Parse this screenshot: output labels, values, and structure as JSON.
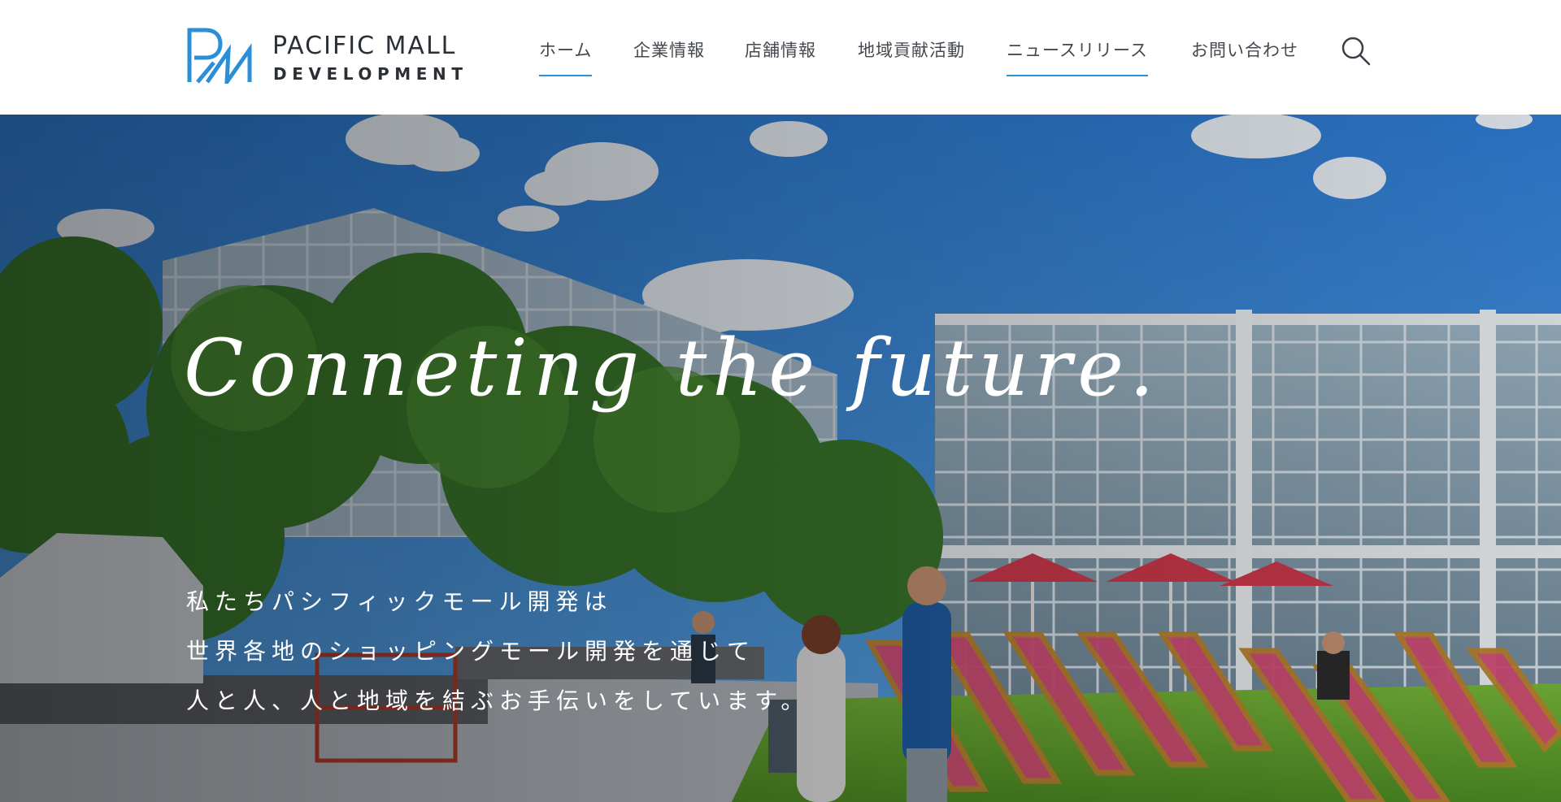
{
  "brand": {
    "line1": "PACIFIC MALL",
    "line2": "DEVELOPMENT",
    "mark_color": "#2a8fd6"
  },
  "nav": {
    "items": [
      {
        "label": "ホーム",
        "active": true
      },
      {
        "label": "企業情報",
        "active": false
      },
      {
        "label": "店舗情報",
        "active": false
      },
      {
        "label": "地域貢献活動",
        "active": false
      },
      {
        "label": "ニュースリリース",
        "active": false,
        "underlined": true
      },
      {
        "label": "お問い合わせ",
        "active": false
      }
    ],
    "search_icon": "search-icon",
    "underline_color": "#2a8fd6"
  },
  "hero": {
    "heading": "Conneting the future.",
    "lines": [
      "私たちパシフィックモール開発は",
      "世界各地のショッピングモール開発を通じて",
      "人と人、人と地域を結ぶお手伝いをしています。"
    ]
  }
}
